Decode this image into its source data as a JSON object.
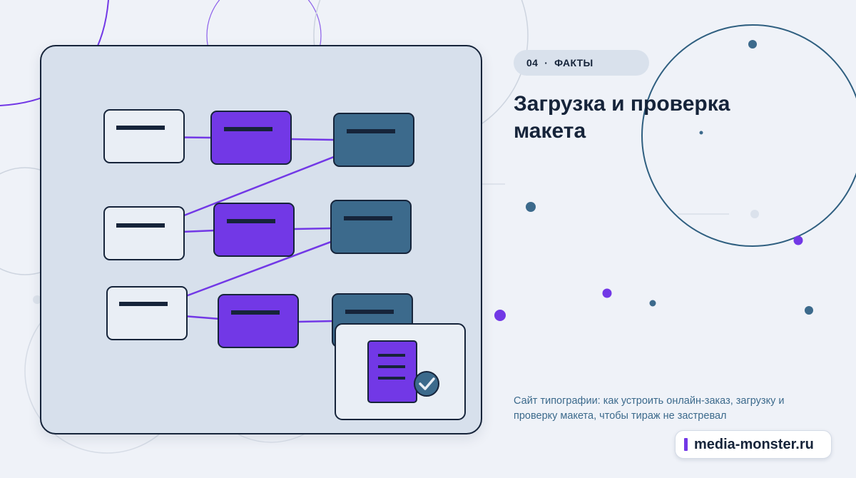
{
  "section": {
    "number": "04",
    "separator": "·",
    "label": "ФАКТЫ"
  },
  "title": "Загрузка и проверка макета",
  "description": "Сайт типографии: как устроить онлайн-заказ, загрузку и проверку макета, чтобы тираж не застревал",
  "brand": {
    "name": "media-monster.ru"
  },
  "colors": {
    "background": "#eff2f8",
    "panel": "#d7e0ec",
    "ink": "#16243a",
    "purple": "#7238e6",
    "steel_blue": "#3c6a8c"
  },
  "illustration": {
    "left_column": "light-cards",
    "middle_column": "purple-cards",
    "right_column": "steel-blue-cards",
    "badge": "document-check-icon"
  }
}
